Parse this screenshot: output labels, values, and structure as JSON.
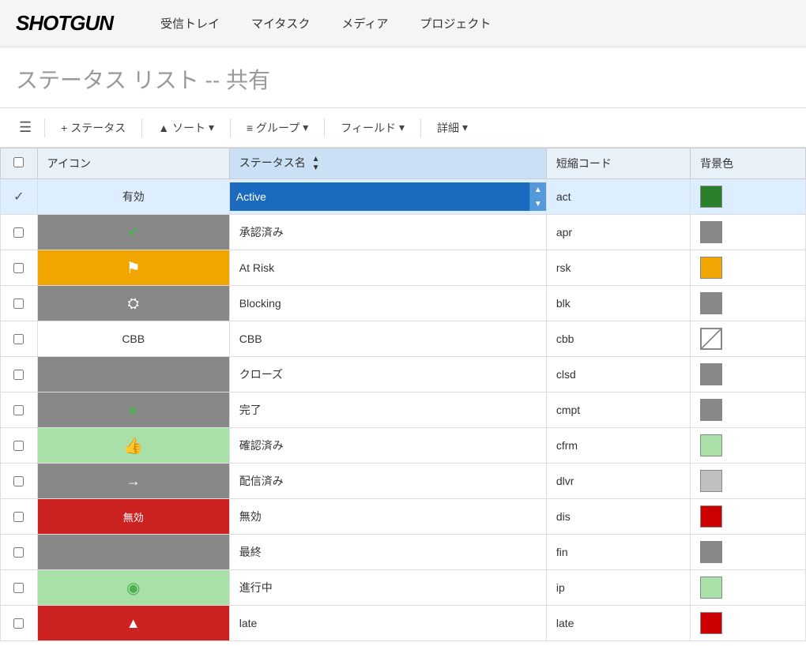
{
  "logo": "SHOTGUN",
  "nav": {
    "items": [
      {
        "label": "受信トレイ"
      },
      {
        "label": "マイタスク"
      },
      {
        "label": "メディア"
      },
      {
        "label": "プロジェクト"
      }
    ]
  },
  "page": {
    "title": "ステータス リスト",
    "subtitle": "-- 共有"
  },
  "toolbar": {
    "list_icon": "☰",
    "add_status": "+ ステータス",
    "sort_label": "▲ ソート",
    "sort_arrow": "▾",
    "group_label": "≡ グループ",
    "group_arrow": "▾",
    "field_label": "フィールド",
    "field_arrow": "▾",
    "detail_label": "詳細",
    "detail_arrow": "▾"
  },
  "table": {
    "columns": [
      {
        "key": "checkbox",
        "label": ""
      },
      {
        "key": "icon",
        "label": "アイコン"
      },
      {
        "key": "name",
        "label": "ステータス名"
      },
      {
        "key": "code",
        "label": "短縮コード"
      },
      {
        "key": "color",
        "label": "背景色"
      }
    ],
    "rows": [
      {
        "id": 1,
        "icon_type": "none",
        "icon_label": "有効",
        "name": "Active",
        "name_editing": true,
        "code": "act",
        "color_class": "swatch-green",
        "selected": true
      },
      {
        "id": 2,
        "icon_type": "gray",
        "icon_symbol": "✔",
        "icon_color": "#4caf50",
        "name": "承認済み",
        "code": "apr",
        "color_class": "swatch-gray"
      },
      {
        "id": 3,
        "icon_type": "yellow",
        "icon_symbol": "⚑",
        "name": "At Risk",
        "code": "rsk",
        "color_class": "swatch-yellow"
      },
      {
        "id": 4,
        "icon_type": "gray",
        "icon_symbol": "⛭",
        "name": "Blocking",
        "code": "blk",
        "color_class": "swatch-gray"
      },
      {
        "id": 5,
        "icon_type": "none",
        "icon_label": "CBB",
        "name": "CBB",
        "code": "cbb",
        "color_class": "swatch-cbb"
      },
      {
        "id": 6,
        "icon_type": "gray",
        "icon_symbol": "●",
        "icon_color": "#888",
        "name": "クローズ",
        "code": "clsd",
        "color_class": "swatch-gray"
      },
      {
        "id": 7,
        "icon_type": "gray",
        "icon_symbol": "●",
        "icon_color": "#4caf50",
        "name": "完了",
        "code": "cmpt",
        "color_class": "swatch-gray"
      },
      {
        "id": 8,
        "icon_type": "lightgreen",
        "icon_symbol": "👍",
        "name": "確認済み",
        "code": "cfrm",
        "color_class": "swatch-lightgreen"
      },
      {
        "id": 9,
        "icon_type": "gray",
        "icon_symbol": "→",
        "name": "配信済み",
        "code": "dlvr",
        "color_class": "swatch-verylightgray"
      },
      {
        "id": 10,
        "icon_type": "red",
        "icon_label": "無効",
        "name": "無効",
        "code": "dis",
        "color_class": "swatch-red"
      },
      {
        "id": 11,
        "icon_type": "gray",
        "icon_symbol": "●",
        "icon_color": "#888",
        "name": "最終",
        "code": "fin",
        "color_class": "swatch-gray"
      },
      {
        "id": 12,
        "icon_type": "lightgreen",
        "icon_symbol": "◉",
        "icon_color": "#4caf50",
        "name": "進行中",
        "code": "ip",
        "color_class": "swatch-lightgreen"
      },
      {
        "id": 13,
        "icon_type": "red",
        "icon_symbol": "▲",
        "name": "late",
        "code": "late",
        "color_class": "swatch-red"
      }
    ]
  }
}
